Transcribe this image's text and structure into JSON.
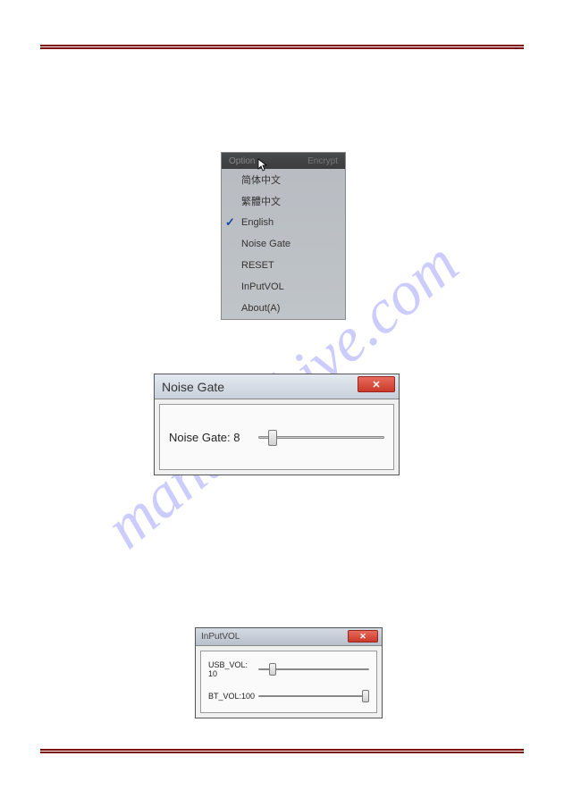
{
  "watermark": "manualshive.com",
  "menu": {
    "menubar": {
      "option": "Option",
      "encrypt": "Encrypt"
    },
    "items": [
      {
        "label": "简体中文",
        "checked": false
      },
      {
        "label": "繁體中文",
        "checked": false
      },
      {
        "label": "English",
        "checked": true
      },
      {
        "label": "Noise Gate",
        "checked": false
      },
      {
        "label": "RESET",
        "checked": false
      },
      {
        "label": "InPutVOL",
        "checked": false
      },
      {
        "label": "About(A)",
        "checked": false
      }
    ]
  },
  "noiseGate": {
    "title": "Noise Gate",
    "label": "Noise Gate:",
    "value": "8",
    "sliderPercent": 8
  },
  "inputVol": {
    "title": "InPutVOL",
    "rows": [
      {
        "label": "USB_VOL:",
        "value": "10",
        "sliderPercent": 10
      },
      {
        "label": "BT_VOL:",
        "value": "100",
        "sliderPercent": 100
      }
    ]
  }
}
